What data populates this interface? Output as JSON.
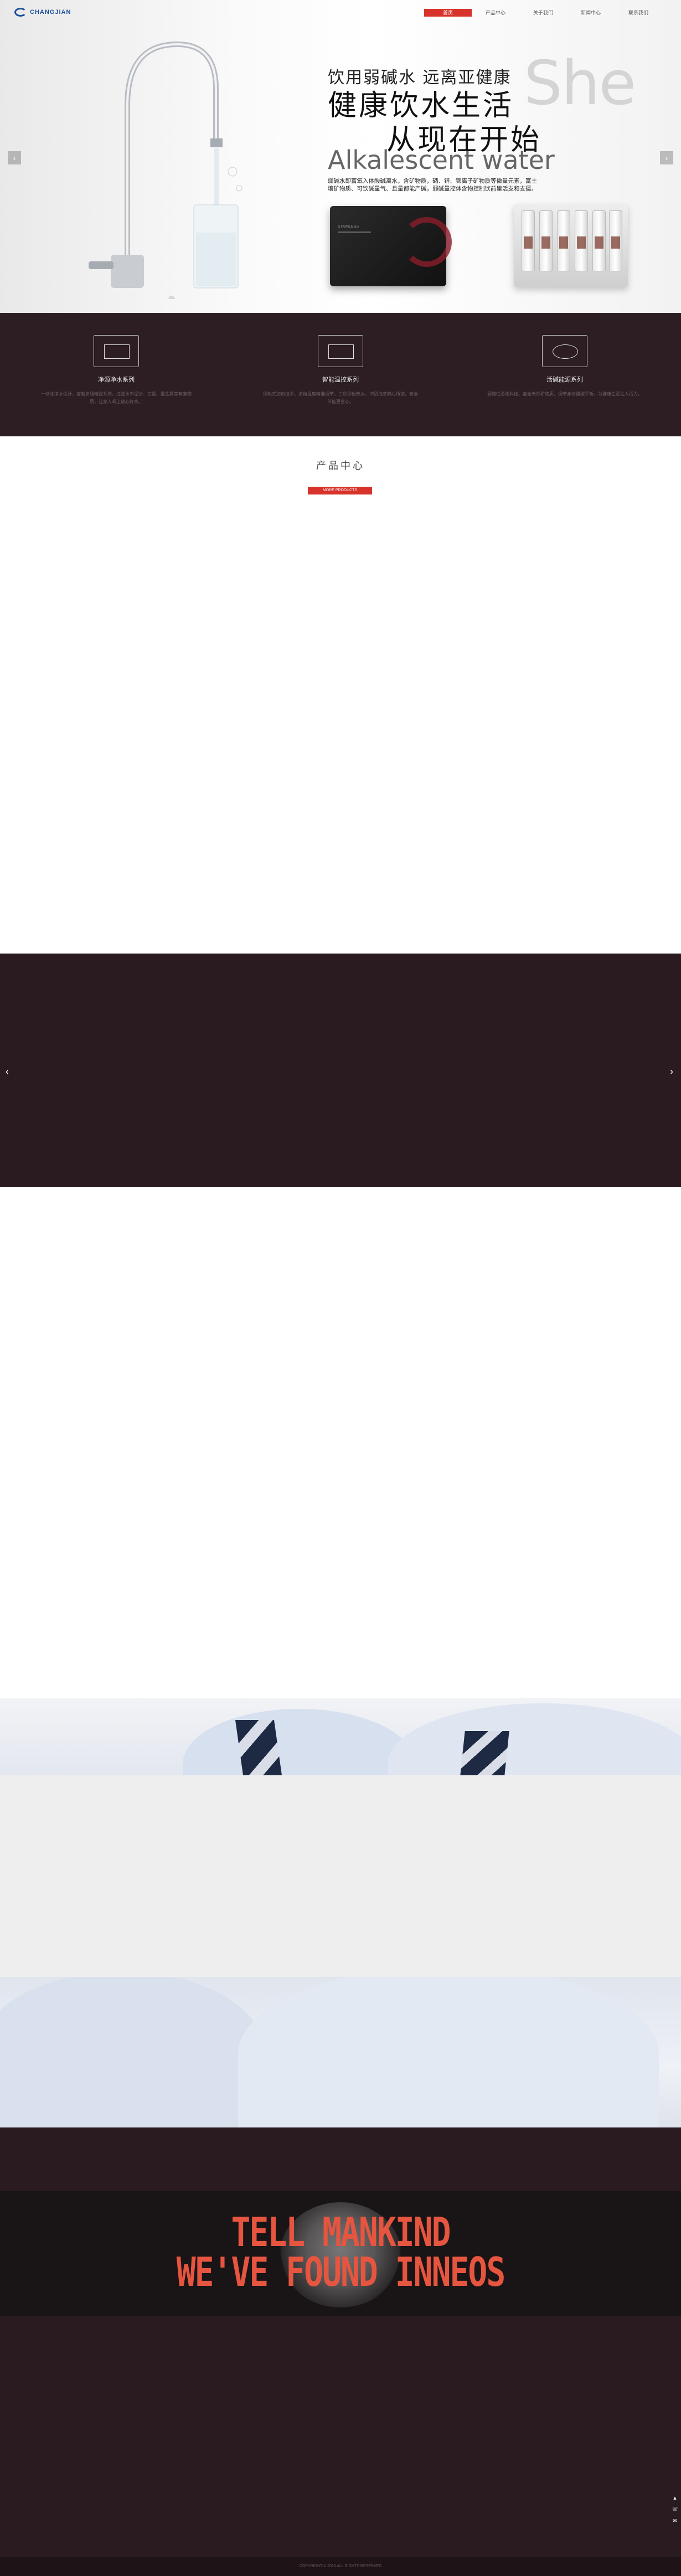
{
  "header": {
    "logo_text": "CHANGJIAN",
    "nav": [
      "首页",
      "产品中心",
      "关于我们",
      "新闻中心",
      "联系我们"
    ],
    "active_index": 0
  },
  "hero": {
    "line1": "饮用弱碱水 远离亚健康",
    "she": "She",
    "line2": "健康饮水生活",
    "line3": "从现在开始",
    "english": "Alkalescent water",
    "description": "弱碱水即富氧入体酸碱离水，含矿物质，硒、锌、锶离子矿物质等微量元素，富土壤矿物质、可饮碱量气、且量都能产碱，弱碱量控体含物控制饮前里活支和支摄。",
    "arrow_left": "‹",
    "arrow_right": "›"
  },
  "features": [
    {
      "title": "净源净水系列",
      "text": "一体化净水设计，搭载多级精滤系统，过滤水中泥沙、余氯、重金属等有害物质，让家人喝上放心好水。"
    },
    {
      "title": "智能温控系列",
      "text": "即热式加热技术，多档温度精准调节，三秒即出热水，冲奶泡茶随心所欲，安全节能更省心。"
    },
    {
      "title": "活碱能源系列",
      "text": "弱碱性活化科技，富含天然矿物质，调节身体酸碱平衡，为健康生活注入活力。"
    }
  ],
  "product_center": {
    "title": "产品中心",
    "button": "MORE PRODUCTS"
  },
  "carousel": {
    "arrow_left": "‹",
    "arrow_right": "›"
  },
  "tell_band": {
    "line1": "TELL MANKIND",
    "line2": "WE'VE FOUND INNEOS"
  },
  "footer": {
    "text": "COPYRIGHT © 2016 ALL RIGHTS RESERVED"
  },
  "side_tools": [
    "▲",
    "☏",
    "✉"
  ]
}
